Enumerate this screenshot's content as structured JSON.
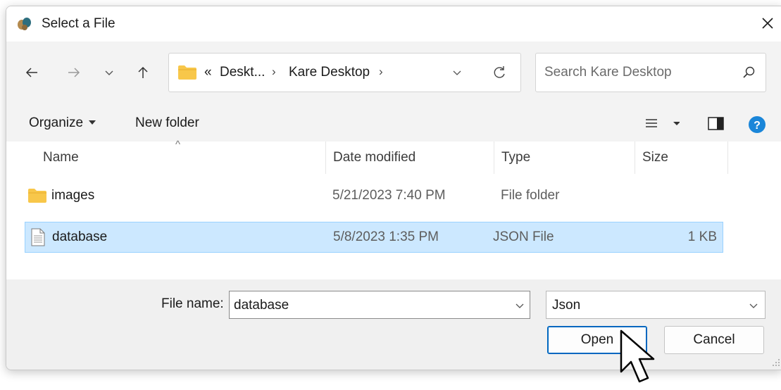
{
  "window": {
    "title": "Select a File",
    "icons": {
      "app": "app-icon",
      "close": "close-icon"
    }
  },
  "nav": {
    "icons": [
      "back-arrow-icon",
      "forward-arrow-icon",
      "recent-locations-chevron-icon",
      "up-arrow-icon"
    ],
    "address": {
      "overflow": "«",
      "crumbs": [
        "Deskt...",
        "Kare Desktop"
      ],
      "separator": "›",
      "icons": [
        "folder-icon",
        "chevron-down-icon",
        "refresh-icon"
      ]
    },
    "search": {
      "placeholder": "Search Kare Desktop",
      "value": "",
      "icon": "search-icon"
    }
  },
  "toolbar": {
    "organize_label": "Organize",
    "new_folder_label": "New folder",
    "icons": [
      "view-options-icon",
      "preview-pane-icon",
      "help-icon"
    ]
  },
  "file_list": {
    "columns": [
      "Name",
      "Date modified",
      "Type",
      "Size"
    ],
    "sort_indicator": "^",
    "rows": [
      {
        "name": "images",
        "date": "5/21/2023 7:40 PM",
        "type": "File folder",
        "size": "",
        "icon": "folder-icon",
        "selected": false
      },
      {
        "name": "database",
        "date": "5/8/2023 1:35 PM",
        "type": "JSON File",
        "size": "1 KB",
        "icon": "json-file-icon",
        "selected": true
      }
    ]
  },
  "footer": {
    "file_name_label": "File name:",
    "file_name_value": "database",
    "file_type_value": "Json",
    "open_label": "Open",
    "cancel_label": "Cancel"
  },
  "colors": {
    "selection_bg": "#cce8ff",
    "selection_border": "#99d1ff",
    "folder_yellow": "#f8c74a",
    "help_blue": "#1a86d9",
    "primary_border": "#0067c0",
    "chrome_bg": "#f3f3f3"
  },
  "cursor": {
    "icon": "mouse-pointer-icon"
  }
}
